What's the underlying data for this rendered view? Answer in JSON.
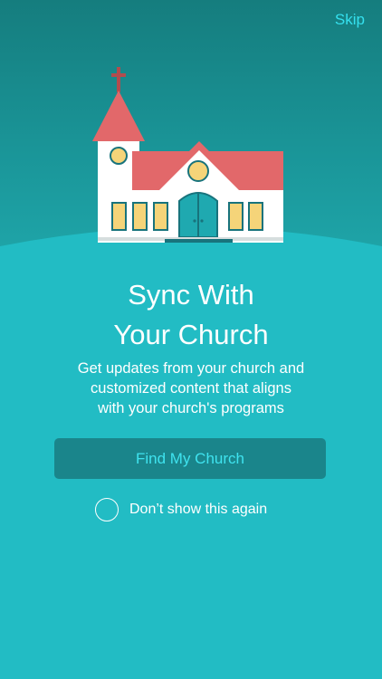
{
  "header": {
    "skip_label": "Skip"
  },
  "intro": {
    "title_lines": [
      "Sync With",
      "Your Church"
    ],
    "subtitle_lines": [
      "Get updates from your church and",
      "customized content that aligns",
      "with your church's programs"
    ]
  },
  "actions": {
    "find_button_label": "Find My Church",
    "dont_show_label": "Don’t show this again",
    "dont_show_checked": false
  },
  "colors": {
    "background": "#22bcc4",
    "top_band": "#1a9598",
    "accent_text": "#35e0ee",
    "button_fill": "#1a858b",
    "roof": "#e2686a",
    "church_wall": "#ffffff",
    "window_fill": "#f5d479",
    "door": "#1fa9b0"
  },
  "illustration": {
    "icons": [
      "church-icon",
      "cross-icon"
    ]
  }
}
